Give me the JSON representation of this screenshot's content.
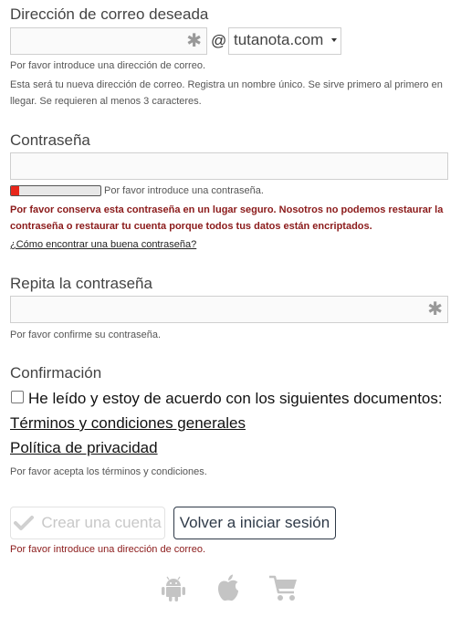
{
  "email": {
    "label": "Dirección de correo deseada",
    "value": "",
    "required_mark": "✱",
    "at": "@",
    "domain": "tutanota.com",
    "error": "Por favor introduce una dirección de correo.",
    "help": "Esta será tu nueva dirección de correo. Registra un nombre único. Se sirve primero al primero en llegar. Se requieren al menos 3 caracteres."
  },
  "password": {
    "label": "Contraseña",
    "value": "",
    "strength_fraction": 0.09,
    "strength_text": "Por favor introduce una contraseña.",
    "warning": "Por favor conserva esta contraseña en un lugar seguro. Nosotros no podemos restaurar la contraseña o restaurar tu cuenta porque todos tus datos están encriptados.",
    "help_link": "¿Cómo encontrar una buena contraseña?"
  },
  "repeat": {
    "label": "Repita la contraseña",
    "value": "",
    "required_mark": "✱",
    "error": "Por favor confirme su contraseña."
  },
  "confirmation": {
    "label": "Confirmación",
    "checkbox_label": "He leído y estoy de acuerdo con los siguientes documentos:",
    "terms_link": "Términos y condiciones generales",
    "privacy_link": "Política de privacidad",
    "error": "Por favor acepta los términos y condiciones."
  },
  "actions": {
    "create_label": "Crear una cuenta",
    "back_label": "Volver a iniciar sesión",
    "error": "Por favor introduce una dirección de correo."
  },
  "footer": {
    "icons": [
      "android-icon",
      "apple-icon",
      "cart-icon"
    ]
  },
  "colors": {
    "error": "#8b1a1a",
    "strength_bar": "#e8271b",
    "button_border": "#2f3a48"
  }
}
